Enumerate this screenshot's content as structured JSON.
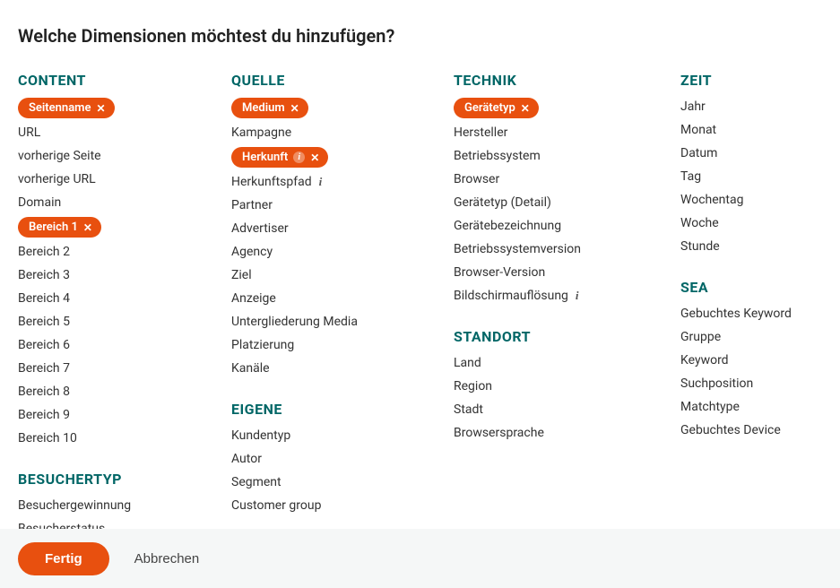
{
  "title": "Welche Dimensionen möchtest du hinzufügen?",
  "columns": [
    {
      "groups": [
        {
          "heading": "CONTENT",
          "name": "content",
          "items": [
            {
              "label": "Seitenname",
              "selected": true
            },
            {
              "label": "URL"
            },
            {
              "label": "vorherige Seite"
            },
            {
              "label": "vorherige URL"
            },
            {
              "label": "Domain"
            },
            {
              "label": "Bereich 1",
              "selected": true
            },
            {
              "label": "Bereich 2"
            },
            {
              "label": "Bereich 3"
            },
            {
              "label": "Bereich 4"
            },
            {
              "label": "Bereich 5"
            },
            {
              "label": "Bereich 6"
            },
            {
              "label": "Bereich 7"
            },
            {
              "label": "Bereich 8"
            },
            {
              "label": "Bereich 9"
            },
            {
              "label": "Bereich 10"
            }
          ]
        },
        {
          "heading": "BESUCHERTYP",
          "name": "besuchertyp",
          "items": [
            {
              "label": "Besuchergewinnung"
            },
            {
              "label": "Besucherstatus"
            }
          ]
        }
      ]
    },
    {
      "groups": [
        {
          "heading": "QUELLE",
          "name": "quelle",
          "items": [
            {
              "label": "Medium",
              "selected": true
            },
            {
              "label": "Kampagne"
            },
            {
              "label": "Herkunft",
              "selected": true,
              "info": true
            },
            {
              "label": "Herkunftspfad",
              "info": true
            },
            {
              "label": "Partner"
            },
            {
              "label": "Advertiser"
            },
            {
              "label": "Agency"
            },
            {
              "label": "Ziel"
            },
            {
              "label": "Anzeige"
            },
            {
              "label": "Untergliederung Media"
            },
            {
              "label": "Platzierung"
            },
            {
              "label": "Kanäle"
            }
          ]
        },
        {
          "heading": "EIGENE",
          "name": "eigene",
          "items": [
            {
              "label": "Kundentyp"
            },
            {
              "label": "Autor"
            },
            {
              "label": "Segment"
            },
            {
              "label": "Customer group"
            }
          ]
        }
      ]
    },
    {
      "groups": [
        {
          "heading": "TECHNIK",
          "name": "technik",
          "items": [
            {
              "label": "Gerätetyp",
              "selected": true
            },
            {
              "label": "Hersteller"
            },
            {
              "label": "Betriebssystem"
            },
            {
              "label": "Browser"
            },
            {
              "label": "Gerätetyp (Detail)"
            },
            {
              "label": "Gerätebezeichnung"
            },
            {
              "label": "Betriebssystemversion"
            },
            {
              "label": "Browser-Version"
            },
            {
              "label": "Bildschirmauflösung",
              "info": true
            }
          ]
        },
        {
          "heading": "STANDORT",
          "name": "standort",
          "items": [
            {
              "label": "Land"
            },
            {
              "label": "Region"
            },
            {
              "label": "Stadt"
            },
            {
              "label": "Browsersprache"
            }
          ]
        }
      ]
    },
    {
      "groups": [
        {
          "heading": "ZEIT",
          "name": "zeit",
          "items": [
            {
              "label": "Jahr"
            },
            {
              "label": "Monat"
            },
            {
              "label": "Datum"
            },
            {
              "label": "Tag"
            },
            {
              "label": "Wochentag"
            },
            {
              "label": "Woche"
            },
            {
              "label": "Stunde"
            }
          ]
        },
        {
          "heading": "SEA",
          "name": "sea",
          "items": [
            {
              "label": "Gebuchtes Keyword"
            },
            {
              "label": "Gruppe"
            },
            {
              "label": "Keyword"
            },
            {
              "label": "Suchposition"
            },
            {
              "label": "Matchtype"
            },
            {
              "label": "Gebuchtes Device"
            }
          ]
        }
      ]
    }
  ],
  "footer": {
    "primary": "Fertig",
    "secondary": "Abbrechen"
  }
}
